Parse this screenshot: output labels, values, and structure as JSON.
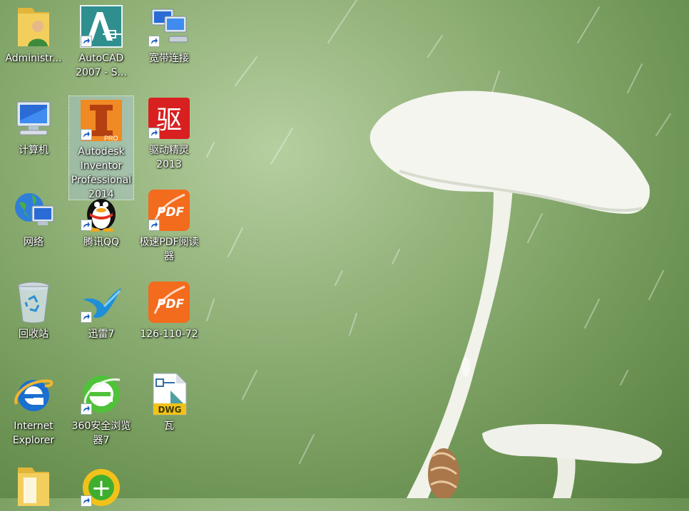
{
  "desktop": {
    "icons": [
      {
        "id": "administrator",
        "label": "Administr...",
        "icon": "user-folder-icon",
        "shortcut": false
      },
      {
        "id": "autocad",
        "label": "AutoCAD 2007 - S...",
        "icon": "autocad-icon",
        "shortcut": true
      },
      {
        "id": "broadband",
        "label": "宽带连接",
        "icon": "network-connection-icon",
        "shortcut": true
      },
      {
        "id": "computer",
        "label": "计算机",
        "icon": "computer-icon",
        "shortcut": false
      },
      {
        "id": "inventor",
        "label": "Autodesk Inventor Professional 2014",
        "icon": "inventor-icon",
        "badge": "PRO",
        "shortcut": true,
        "selected": true
      },
      {
        "id": "driver-genius",
        "label": "驱动精灵 2013",
        "icon": "driver-genius-icon",
        "glyph": "驱",
        "shortcut": true
      },
      {
        "id": "network",
        "label": "网络",
        "icon": "network-globe-icon",
        "shortcut": false
      },
      {
        "id": "qq",
        "label": "腾讯QQ",
        "icon": "qq-penguin-icon",
        "shortcut": true
      },
      {
        "id": "pdf-reader",
        "label": "极速PDF阅读器",
        "icon": "pdf-icon",
        "glyph": "PDF",
        "shortcut": true
      },
      {
        "id": "recycle-bin",
        "label": "回收站",
        "icon": "recycle-bin-icon",
        "shortcut": false
      },
      {
        "id": "xunlei",
        "label": "迅雷7",
        "icon": "xunlei-bird-icon",
        "shortcut": true
      },
      {
        "id": "pdf-file",
        "label": "126-110-72",
        "icon": "pdf-icon",
        "glyph": "PDF",
        "shortcut": false
      },
      {
        "id": "ie",
        "label": "Internet Explorer",
        "icon": "internet-explorer-icon",
        "shortcut": false
      },
      {
        "id": "360browser",
        "label": "360安全浏览器7",
        "icon": "360-browser-icon",
        "shortcut": true
      },
      {
        "id": "dwg",
        "label": "瓦",
        "icon": "dwg-file-icon",
        "glyph": "DWG",
        "shortcut": false
      },
      {
        "id": "folder-bottom",
        "label": "",
        "icon": "folder-icon",
        "shortcut": false
      },
      {
        "id": "360-bottom",
        "label": "",
        "icon": "360-app-icon",
        "glyph": "+",
        "shortcut": true
      }
    ]
  },
  "colors": {
    "wallpaper_green": "#7fa366",
    "autocad_teal": "#2f8f8f",
    "driver_red": "#d82020",
    "pdf_orange": "#f36b1c",
    "ie_blue": "#1a6fd0",
    "green_360": "#4fc23a",
    "selection": "#b4cdf0"
  }
}
